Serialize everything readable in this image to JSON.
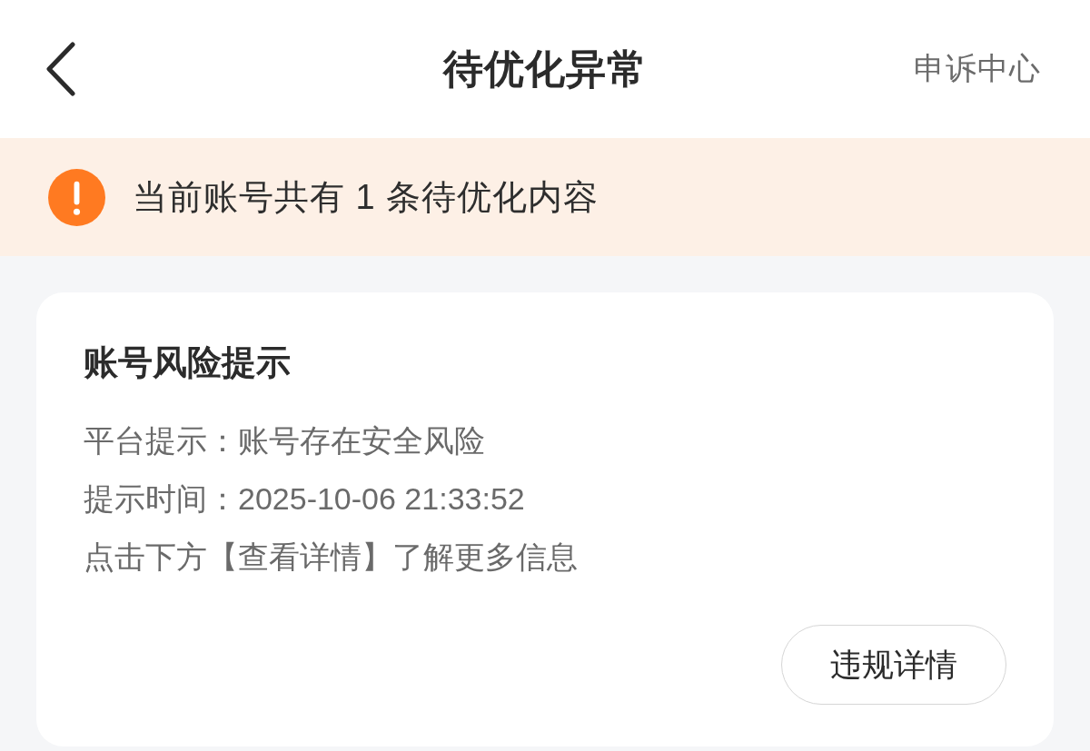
{
  "header": {
    "title": "待优化异常",
    "action": "申诉中心"
  },
  "notice": {
    "text": "当前账号共有 1 条待优化内容"
  },
  "card": {
    "title": "账号风险提示",
    "lines": [
      "平台提示：账号存在安全风险",
      "提示时间：2025-10-06 21:33:52",
      "点击下方【查看详情】了解更多信息"
    ],
    "button": "违规详情"
  }
}
